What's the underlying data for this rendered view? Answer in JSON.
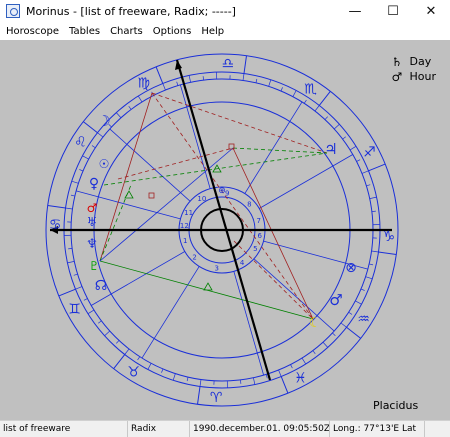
{
  "window": {
    "title": "Morinus - [list of freeware, Radix; -----]",
    "minimize": "—",
    "maximize": "☐",
    "close": "✕"
  },
  "menu": {
    "items": [
      "Horoscope",
      "Tables",
      "Charts",
      "Options",
      "Help"
    ]
  },
  "legend": {
    "day_symbol": "♄",
    "day_label": "Day",
    "hour_symbol": "♂",
    "hour_label": "Hour"
  },
  "house_system": "Placidus",
  "house_numbers": [
    "1",
    "2",
    "3",
    "4",
    "5",
    "6",
    "7",
    "8",
    "9",
    "10",
    "11",
    "12"
  ],
  "zodiac_signs": [
    "♎",
    "♍",
    "♌",
    "♋",
    "♊",
    "♉",
    "♈",
    "♓",
    "♒",
    "♑",
    "♐",
    "♏"
  ],
  "planets": {
    "moon": "☽",
    "jupiter": "♃",
    "venus": "♀",
    "mars_red": "♂",
    "neptune": "♆",
    "uranus": "♅",
    "node": "☊",
    "pluto": "♇",
    "mars": "♂",
    "sun": "☉",
    "lot": "⊗",
    "moon2": "☾",
    "asc_mark": "⊕"
  },
  "statusbar": {
    "name": "list of freeware",
    "type": "Radix",
    "datetime": "1990.december.01. 09:05:50ZN",
    "longitude": "Long.: 77°13'E Lat"
  },
  "colors": {
    "chart_bg": "#c0c0c0",
    "blue": "#1a2fd8",
    "green_planet": "#00a000",
    "red_planet": "#d80000",
    "yellow_planet": "#e6d000"
  }
}
